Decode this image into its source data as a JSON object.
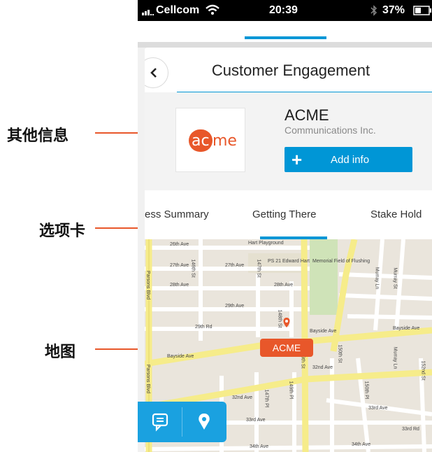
{
  "annotations": {
    "other_info": "其他信息",
    "tabs": "选项卡",
    "map": "地图"
  },
  "status_bar": {
    "carrier": "Cellcom",
    "time": "20:39",
    "battery": "37%"
  },
  "header": {
    "title": "Customer Engagement"
  },
  "company": {
    "logo_text": "acme",
    "name": "ACME",
    "subtitle": "Communications Inc.",
    "add_button_label": "Add info"
  },
  "tabs": [
    {
      "label": "ess Summary"
    },
    {
      "label": "Getting There",
      "active": true
    },
    {
      "label": "Stake Hold"
    }
  ],
  "map": {
    "pin_label": "ACME",
    "streets": [
      "26th Ave",
      "27th Ave",
      "27th Ave",
      "28th Ave",
      "28th Ave",
      "29th Ave",
      "29th Rd",
      "Bayside Ave",
      "Bayside Ave",
      "Bayside Ave",
      "32nd Ave",
      "32nd Ave",
      "33rd Ave",
      "33rd Ave",
      "34th Ave",
      "34th Ave",
      "Parsons Blvd",
      "Parsons Blvd",
      "146th St",
      "147th St",
      "148th St",
      "149th St",
      "150th St",
      "150th St",
      "147th Pl",
      "149th Pl",
      "150th Pl",
      "Murray Ln",
      "Murray St",
      "Murray Ln",
      "152nd St",
      "Hart Playground",
      "PS 21 Edward Hart",
      "Memorial Field of Flushing",
      "Hart",
      "33rd Rd"
    ],
    "colors": {
      "road_major": "#f6ec8a",
      "road_minor": "#ffffff",
      "park": "#cfe3b8",
      "base": "#eae5dc"
    }
  },
  "icons": [
    "signal-icon",
    "wifi-icon",
    "bluetooth-icon",
    "battery-icon",
    "back-chevron-icon",
    "plus-icon",
    "chat-icon",
    "location-pin-icon"
  ],
  "colors": {
    "accent": "#0096d6",
    "orange": "#e8572a"
  }
}
